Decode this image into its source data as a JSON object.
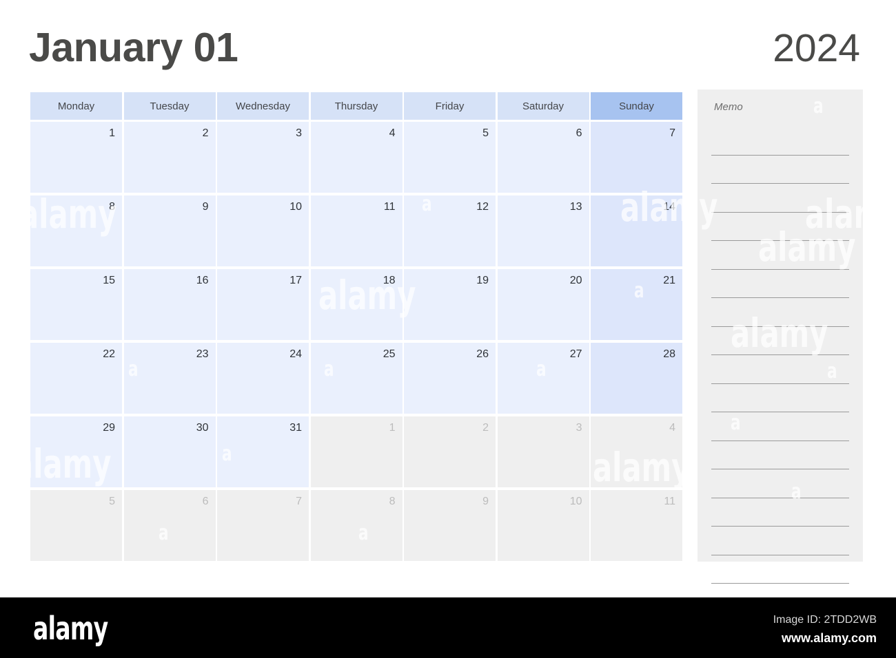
{
  "header": {
    "month_title": "January 01",
    "year": "2024"
  },
  "calendar": {
    "weekdays": [
      {
        "label": "Monday",
        "highlight": false
      },
      {
        "label": "Tuesday",
        "highlight": false
      },
      {
        "label": "Wednesday",
        "highlight": false
      },
      {
        "label": "Thursday",
        "highlight": false
      },
      {
        "label": "Friday",
        "highlight": false
      },
      {
        "label": "Saturday",
        "highlight": false
      },
      {
        "label": "Sunday",
        "highlight": true
      }
    ],
    "weeks": [
      [
        {
          "day": "1",
          "in_month": true,
          "sunday": false
        },
        {
          "day": "2",
          "in_month": true,
          "sunday": false
        },
        {
          "day": "3",
          "in_month": true,
          "sunday": false
        },
        {
          "day": "4",
          "in_month": true,
          "sunday": false
        },
        {
          "day": "5",
          "in_month": true,
          "sunday": false
        },
        {
          "day": "6",
          "in_month": true,
          "sunday": false
        },
        {
          "day": "7",
          "in_month": true,
          "sunday": true
        }
      ],
      [
        {
          "day": "8",
          "in_month": true,
          "sunday": false
        },
        {
          "day": "9",
          "in_month": true,
          "sunday": false
        },
        {
          "day": "10",
          "in_month": true,
          "sunday": false
        },
        {
          "day": "11",
          "in_month": true,
          "sunday": false
        },
        {
          "day": "12",
          "in_month": true,
          "sunday": false
        },
        {
          "day": "13",
          "in_month": true,
          "sunday": false
        },
        {
          "day": "14",
          "in_month": true,
          "sunday": true
        }
      ],
      [
        {
          "day": "15",
          "in_month": true,
          "sunday": false
        },
        {
          "day": "16",
          "in_month": true,
          "sunday": false
        },
        {
          "day": "17",
          "in_month": true,
          "sunday": false
        },
        {
          "day": "18",
          "in_month": true,
          "sunday": false
        },
        {
          "day": "19",
          "in_month": true,
          "sunday": false
        },
        {
          "day": "20",
          "in_month": true,
          "sunday": false
        },
        {
          "day": "21",
          "in_month": true,
          "sunday": true
        }
      ],
      [
        {
          "day": "22",
          "in_month": true,
          "sunday": false
        },
        {
          "day": "23",
          "in_month": true,
          "sunday": false
        },
        {
          "day": "24",
          "in_month": true,
          "sunday": false
        },
        {
          "day": "25",
          "in_month": true,
          "sunday": false
        },
        {
          "day": "26",
          "in_month": true,
          "sunday": false
        },
        {
          "day": "27",
          "in_month": true,
          "sunday": false
        },
        {
          "day": "28",
          "in_month": true,
          "sunday": true
        }
      ],
      [
        {
          "day": "29",
          "in_month": true,
          "sunday": false
        },
        {
          "day": "30",
          "in_month": true,
          "sunday": false
        },
        {
          "day": "31",
          "in_month": true,
          "sunday": false
        },
        {
          "day": "1",
          "in_month": false,
          "sunday": false
        },
        {
          "day": "2",
          "in_month": false,
          "sunday": false
        },
        {
          "day": "3",
          "in_month": false,
          "sunday": false
        },
        {
          "day": "4",
          "in_month": false,
          "sunday": true
        }
      ],
      [
        {
          "day": "5",
          "in_month": false,
          "sunday": false
        },
        {
          "day": "6",
          "in_month": false,
          "sunday": false
        },
        {
          "day": "7",
          "in_month": false,
          "sunday": false
        },
        {
          "day": "8",
          "in_month": false,
          "sunday": false
        },
        {
          "day": "9",
          "in_month": false,
          "sunday": false
        },
        {
          "day": "10",
          "in_month": false,
          "sunday": false
        },
        {
          "day": "11",
          "in_month": false,
          "sunday": true
        }
      ]
    ]
  },
  "memo": {
    "title": "Memo",
    "line_count": 16
  },
  "watermark": {
    "text": "alamy",
    "short": "a"
  },
  "footer": {
    "logo": "alamy",
    "image_id": "Image ID: 2TDD2WB",
    "website": "www.alamy.com"
  },
  "colors": {
    "header_cell": "#d6e2f7",
    "header_sunday": "#a7c3f0",
    "day_cell": "#eaf0fd",
    "day_cell_sunday": "#dde6fb",
    "day_cell_out": "#efefef",
    "memo_bg": "#efefef",
    "text_dark": "#4a4a48",
    "text_muted": "#bcbcbc",
    "footer_bg": "#000000"
  }
}
